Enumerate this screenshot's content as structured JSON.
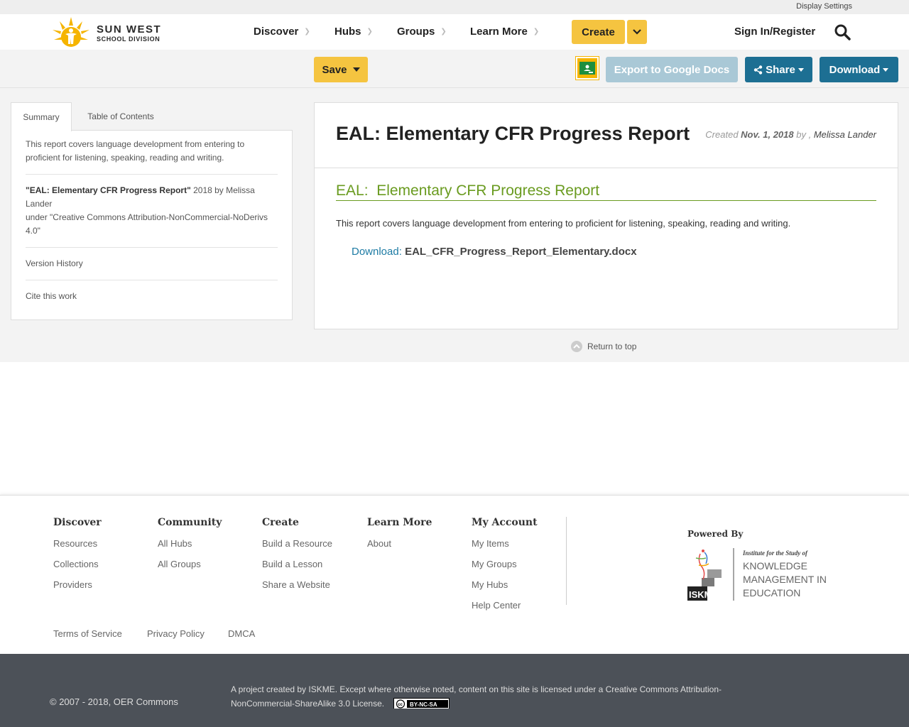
{
  "topbar": {
    "display_settings": "Display Settings"
  },
  "brand": {
    "line1": "SUN WEST",
    "line2": "SCHOOL DIVISION"
  },
  "nav": {
    "items": [
      {
        "label": "Discover"
      },
      {
        "label": "Hubs"
      },
      {
        "label": "Groups"
      },
      {
        "label": "Learn More"
      }
    ],
    "create": "Create",
    "signin": "Sign In/Register"
  },
  "toolbar": {
    "save": "Save",
    "export": "Export to Google Docs",
    "share": "Share",
    "download": "Download"
  },
  "sidebar": {
    "tabs": [
      "Summary",
      "Table of Contents"
    ],
    "summary": "This report covers language development from entering to proficient for listening, speaking, reading and writing.",
    "attribution_title": "\"EAL: Elementary CFR Progress Report\"",
    "attribution_rest": " 2018 by Melissa Lander",
    "attribution_license": "under \"Creative Commons Attribution-NonCommercial-NoDerivs 4.0\"",
    "version_history": "Version History",
    "cite": "Cite this work"
  },
  "resource": {
    "title": "EAL: Elementary CFR Progress Report",
    "created_label": "Created",
    "date": "Nov. 1, 2018",
    "by": "by ,",
    "author": "Melissa Lander",
    "heading": "EAL:  Elementary CFR Progress Report",
    "description": "This report covers language development from entering to proficient for listening, speaking, reading and writing.",
    "download_label": "Download:",
    "download_file": "EAL_CFR_Progress_Report_Elementary.docx"
  },
  "return_top": "Return to top",
  "footer": {
    "columns": [
      {
        "title": "Discover",
        "links": [
          "Resources",
          "Collections",
          "Providers"
        ]
      },
      {
        "title": "Community",
        "links": [
          "All Hubs",
          "All Groups"
        ]
      },
      {
        "title": "Create",
        "links": [
          "Build a Resource",
          "Build a Lesson",
          "Share a Website"
        ]
      },
      {
        "title": "Learn More",
        "links": [
          "About"
        ]
      },
      {
        "title": "My Account",
        "links": [
          "My Items",
          "My Groups",
          "My Hubs",
          "Help Center"
        ]
      }
    ],
    "powered_by": "Powered By",
    "iskme_tagline": "Institute for the Study of",
    "iskme_line1": "KNOWLEDGE",
    "iskme_line2": "MANAGEMENT IN",
    "iskme_line3": "EDUCATION",
    "iskme_abbr": "ISKME",
    "legal": [
      "Terms of Service",
      "Privacy Policy",
      "DMCA"
    ]
  },
  "bottom": {
    "copyright": "© 2007 - 2018, OER Commons",
    "license": "A project created by ISKME. Except where otherwise noted, content on this site is licensed under a Creative Commons Attribution-NonCommercial-ShareAlike 3.0 License.",
    "cc_badge": "BY-NC-SA"
  },
  "colors": {
    "accent_yellow": "#f5c440",
    "primary_blue": "#1d6f93",
    "export_disabled": "#a9c8d6",
    "heading_green": "#6a9b20",
    "footer_dark": "#4c5158"
  }
}
